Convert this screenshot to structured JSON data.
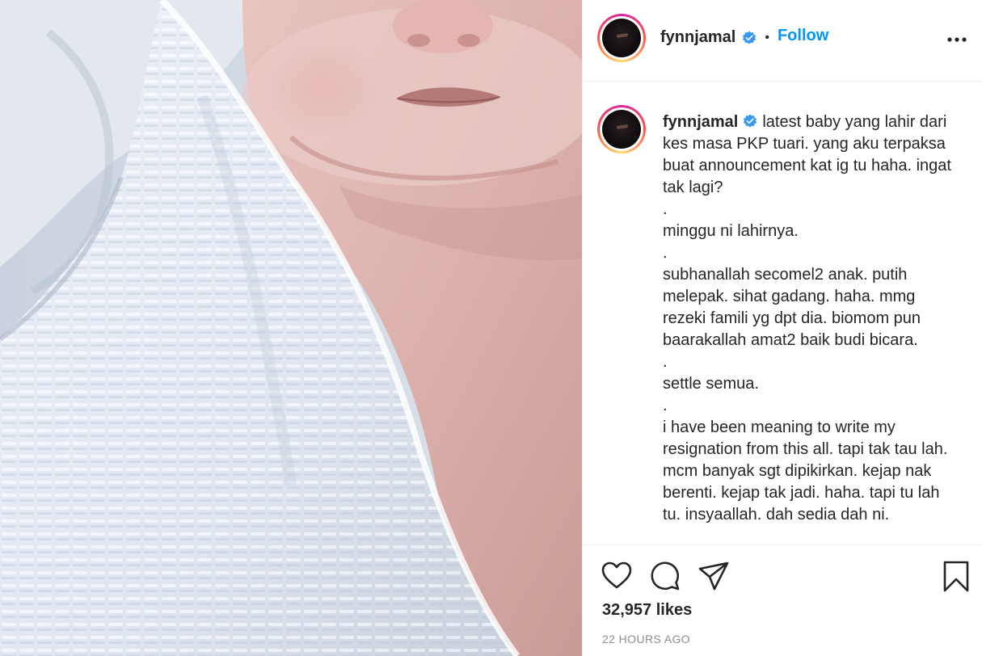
{
  "post": {
    "username": "fynnjamal",
    "follow_label": "Follow",
    "separator": "•",
    "caption_lines": [
      "latest baby yang lahir dari kes masa PKP tuari. yang aku terpaksa buat announcement kat ig tu haha. ingat tak lagi?",
      ".",
      "minggu ni lahirnya.",
      ".",
      "subhanallah secomel2 anak. putih melepak. sihat gadang. haha. mmg rezeki famili yg dpt dia. biomom pun baarakallah amat2 baik budi bicara.",
      ".",
      "settle semua.",
      ".",
      "i have been meaning to write my resignation from this all. tapi tak tau lah. mcm banyak sgt dipikirkan. kejap nak berenti. kejap tak jadi. haha. tapi tu lah tu. insyaallah. dah sedia dah ni."
    ],
    "likes": "32,957 likes",
    "timestamp": "22 HOURS AGO"
  },
  "colors": {
    "accent": "#0095f6",
    "verified": "#3897f0",
    "text": "#262626",
    "muted": "#8e8e8e",
    "divider": "#efefef"
  },
  "icons": {
    "verified": "verified-badge-icon",
    "more": "more-options-icon",
    "like": "heart-icon",
    "comment": "comment-bubble-icon",
    "share": "paper-plane-icon",
    "save": "bookmark-icon"
  }
}
